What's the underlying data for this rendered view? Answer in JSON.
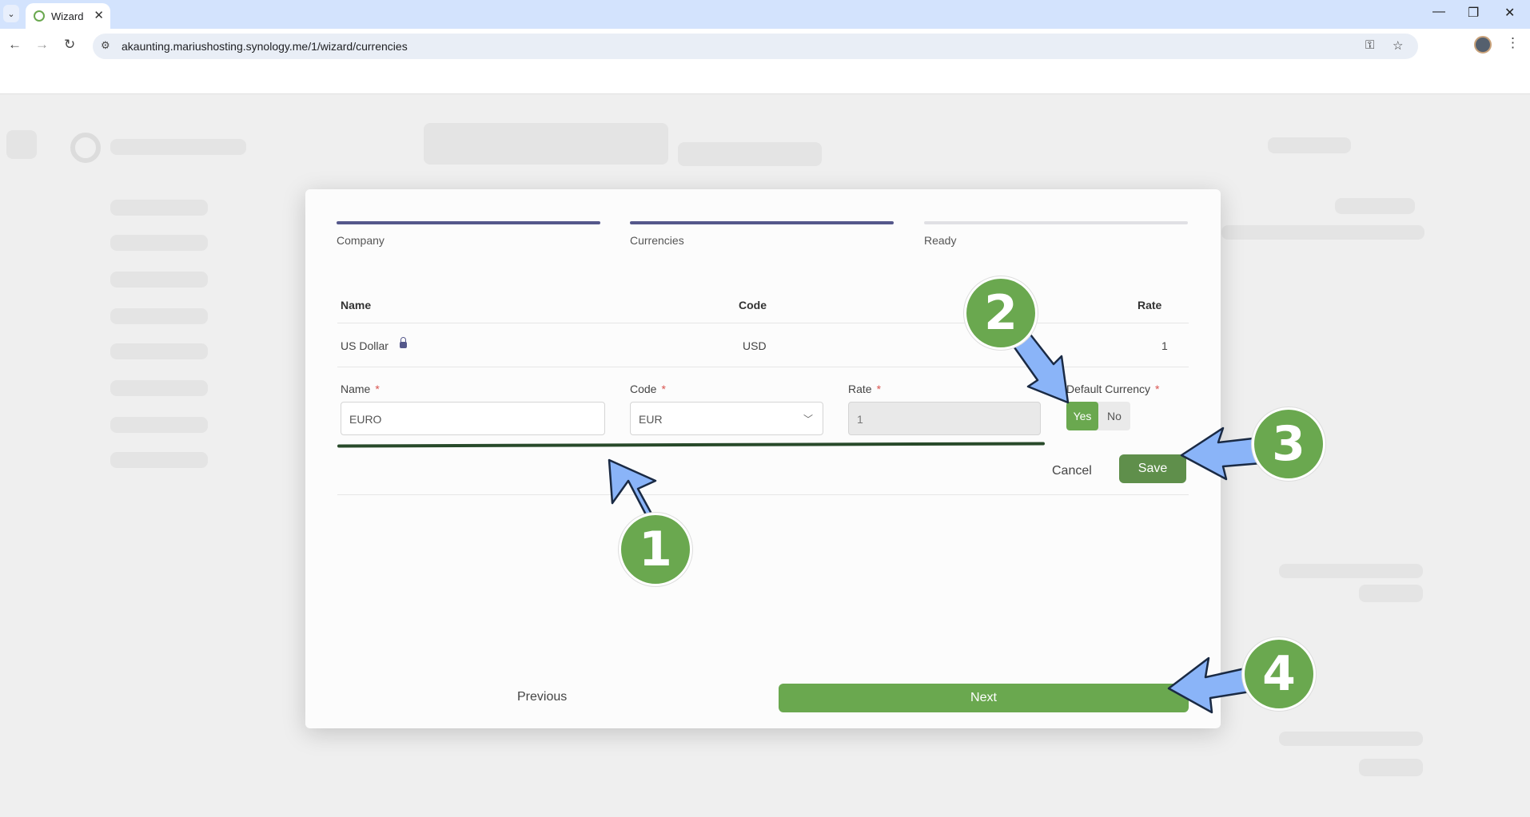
{
  "browser": {
    "tab_title": "Wizard",
    "url": "akaunting.mariushosting.synology.me/1/wizard/currencies"
  },
  "wizard": {
    "steps": [
      {
        "label": "Company",
        "state": "complete"
      },
      {
        "label": "Currencies",
        "state": "active"
      },
      {
        "label": "Ready",
        "state": "pending"
      }
    ],
    "table": {
      "headers": {
        "name": "Name",
        "code": "Code",
        "rate": "Rate"
      },
      "rows": [
        {
          "name": "US Dollar",
          "code": "USD",
          "rate": "1",
          "locked": true
        }
      ]
    },
    "form": {
      "name_label": "Name",
      "name_value": "EURO",
      "code_label": "Code",
      "code_value": "EUR",
      "rate_label": "Rate",
      "rate_value": "1",
      "default_label": "Default Currency",
      "required_mark": "*",
      "yes": "Yes",
      "no": "No",
      "selected": "Yes"
    },
    "cancel_label": "Cancel",
    "save_label": "Save",
    "previous_label": "Previous",
    "next_label": "Next"
  },
  "annotations": {
    "badge_1": "1",
    "badge_2": "2",
    "badge_3": "3",
    "badge_4": "4"
  },
  "colors": {
    "accent_green": "#6aa84f",
    "step_purple": "#55588b",
    "arrow_blue": "#8ab4f8"
  }
}
